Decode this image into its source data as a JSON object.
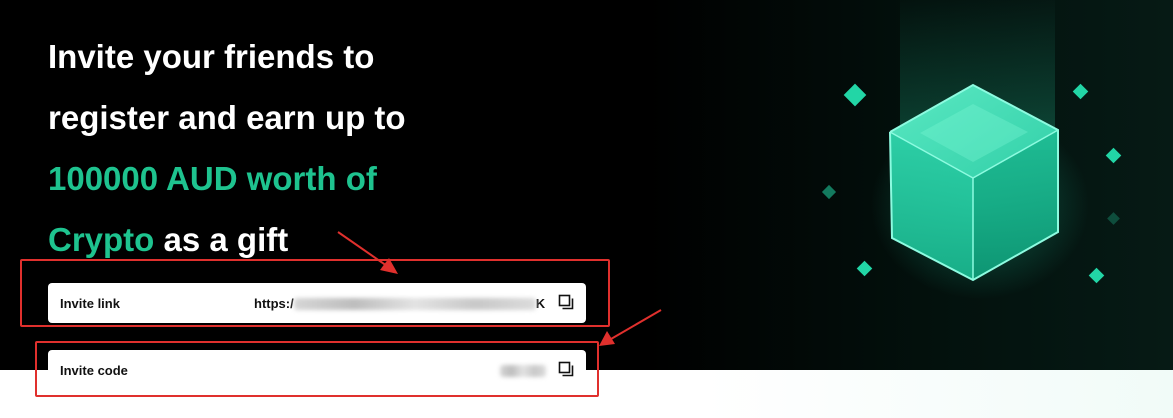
{
  "headline": {
    "line1": "Invite your friends to",
    "line2": "register and earn up to",
    "line3_accent": "100000 AUD worth of",
    "line4_accent": "Crypto",
    "line4_rest": " as a gift"
  },
  "invite_link": {
    "label": "Invite link",
    "value_prefix": "https:/",
    "value_suffix": "K",
    "copy_icon": "copy-icon"
  },
  "invite_code": {
    "label": "Invite code",
    "copy_icon": "copy-icon"
  },
  "colors": {
    "accent": "#1ec38f",
    "background": "#000000",
    "annotation": "#e0302d"
  },
  "illustration": "glowing-green-cube"
}
